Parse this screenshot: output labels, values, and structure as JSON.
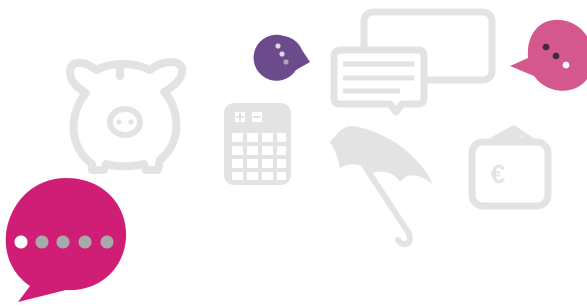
{
  "colors": {
    "background": "#ffffff",
    "line_art": "#e3e3e3",
    "purple": "#6b4b8c",
    "pink": "#d4588e",
    "magenta": "#d01e77",
    "dot_white": "#ffffff",
    "dot_grey": "#a9a9a9"
  },
  "icons": [
    {
      "name": "piggy-bank-icon"
    },
    {
      "name": "calculator-icon"
    },
    {
      "name": "chat-bubbles-icon"
    },
    {
      "name": "umbrella-icon"
    },
    {
      "name": "euro-wallet-icon"
    },
    {
      "name": "purple-typing-bubble-icon"
    },
    {
      "name": "pink-typing-bubble-icon"
    },
    {
      "name": "magenta-typing-bubble-icon"
    }
  ],
  "wallet_symbol": "€"
}
